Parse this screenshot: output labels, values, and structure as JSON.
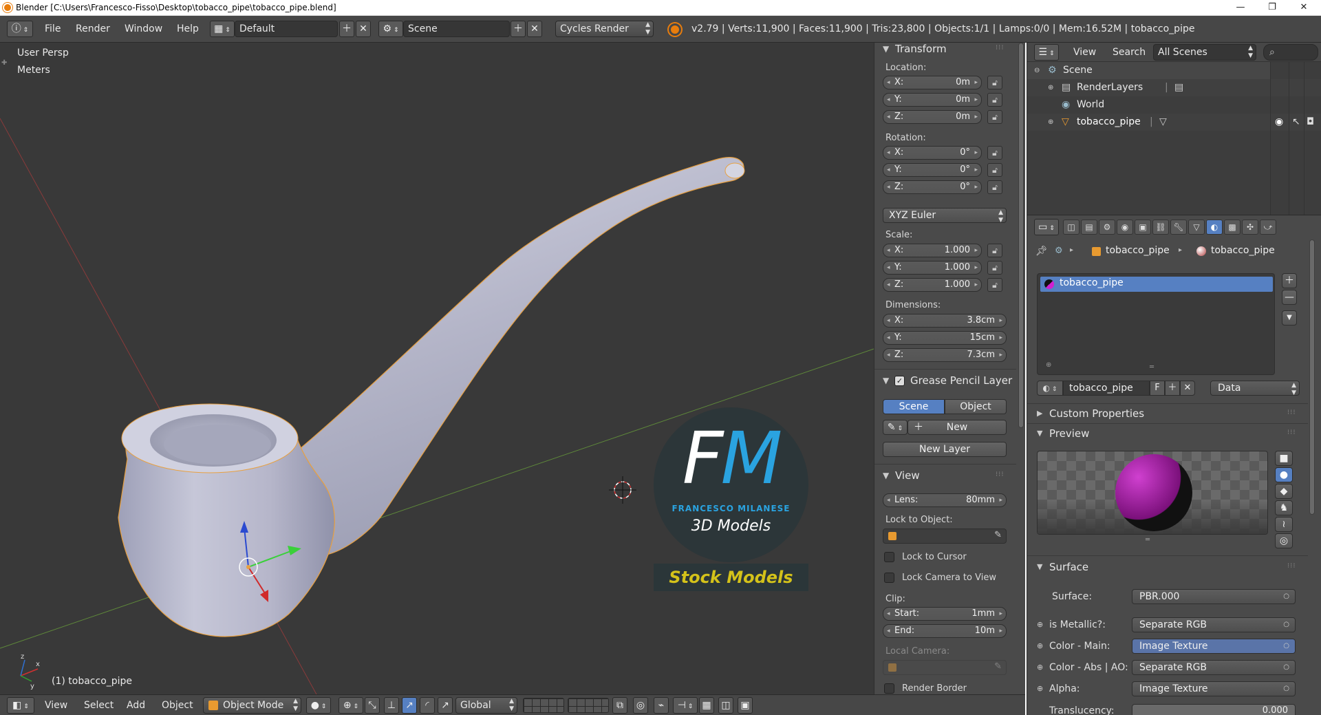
{
  "window": {
    "title": "Blender [C:\\Users\\Francesco-Fisso\\Desktop\\tobacco_pipe\\tobacco_pipe.blend]",
    "minimize": "—",
    "maximize": "❐",
    "close": "✕"
  },
  "header": {
    "menus": [
      "File",
      "Render",
      "Window",
      "Help"
    ],
    "layout": "Default",
    "scene": "Scene",
    "engine": "Cycles Render",
    "stats": "v2.79 | Verts:11,900 | Faces:11,900 | Tris:23,800 | Objects:1/1 | Lamps:0/0 | Mem:16.52M | tobacco_pipe"
  },
  "viewport": {
    "view_name": "User Persp",
    "units": "Meters",
    "object_label": "(1) tobacco_pipe",
    "watermark": {
      "initials": "FM",
      "name": "FRANCESCO MILANESE",
      "tagline": "3D Models",
      "banner": "Stock Models"
    }
  },
  "footer": {
    "menus": [
      "View",
      "Select",
      "Add",
      "Object"
    ],
    "mode": "Object Mode",
    "orientation": "Global"
  },
  "transform": {
    "title": "Transform",
    "location_label": "Location:",
    "location": [
      {
        "k": "X:",
        "v": "0m"
      },
      {
        "k": "Y:",
        "v": "0m"
      },
      {
        "k": "Z:",
        "v": "0m"
      }
    ],
    "rotation_label": "Rotation:",
    "rotation": [
      {
        "k": "X:",
        "v": "0°"
      },
      {
        "k": "Y:",
        "v": "0°"
      },
      {
        "k": "Z:",
        "v": "0°"
      }
    ],
    "rotation_mode": "XYZ Euler",
    "scale_label": "Scale:",
    "scale": [
      {
        "k": "X:",
        "v": "1.000"
      },
      {
        "k": "Y:",
        "v": "1.000"
      },
      {
        "k": "Z:",
        "v": "1.000"
      }
    ],
    "dimensions_label": "Dimensions:",
    "dimensions": [
      {
        "k": "X:",
        "v": "3.8cm"
      },
      {
        "k": "Y:",
        "v": "15cm"
      },
      {
        "k": "Z:",
        "v": "7.3cm"
      }
    ]
  },
  "grease": {
    "title": "Grease Pencil Layer",
    "tab_scene": "Scene",
    "tab_object": "Object",
    "new": "New",
    "new_layer": "New Layer"
  },
  "view": {
    "title": "View",
    "lens_label": "Lens:",
    "lens_value": "80mm",
    "lock_to_object": "Lock to Object:",
    "lock_to_cursor": "Lock to Cursor",
    "lock_camera": "Lock Camera to View",
    "clip_label": "Clip:",
    "clip_start_label": "Start:",
    "clip_start": "1mm",
    "clip_end_label": "End:",
    "clip_end": "10m",
    "local_camera": "Local Camera:",
    "render_border": "Render Border"
  },
  "outliner": {
    "menu_view": "View",
    "menu_search": "Search",
    "scenes_dropdown": "All Scenes",
    "items": [
      {
        "label": "Scene"
      },
      {
        "label": "RenderLayers"
      },
      {
        "label": "World"
      },
      {
        "label": "tobacco_pipe"
      }
    ]
  },
  "properties": {
    "breadcrumb_object": "tobacco_pipe",
    "breadcrumb_material": "tobacco_pipe",
    "slot_name": "tobacco_pipe",
    "material_name": "tobacco_pipe",
    "fake_user": "F",
    "link_dropdown": "Data",
    "custom_properties": "Custom Properties",
    "preview": "Preview",
    "surface_title": "Surface",
    "surface_label": "Surface:",
    "surface_value": "PBR.000",
    "inputs": [
      {
        "label": "is Metallic?:",
        "value": "Separate RGB"
      },
      {
        "label": "Color - Main:",
        "value": "Image Texture"
      },
      {
        "label": "Color - Abs | AO:",
        "value": "Separate RGB"
      },
      {
        "label": "Alpha:",
        "value": "Image Texture"
      }
    ],
    "translucency_label": "Translucency:",
    "translucency_value": "0.000"
  },
  "colors": {
    "accent_blue": "#5680c2",
    "viewport_bg": "#393939",
    "panel_bg": "#4a4a4a",
    "selection_orange": "#e8a040",
    "watermark_blue": "#2aa3e0",
    "watermark_yellow": "#d4c21a"
  }
}
